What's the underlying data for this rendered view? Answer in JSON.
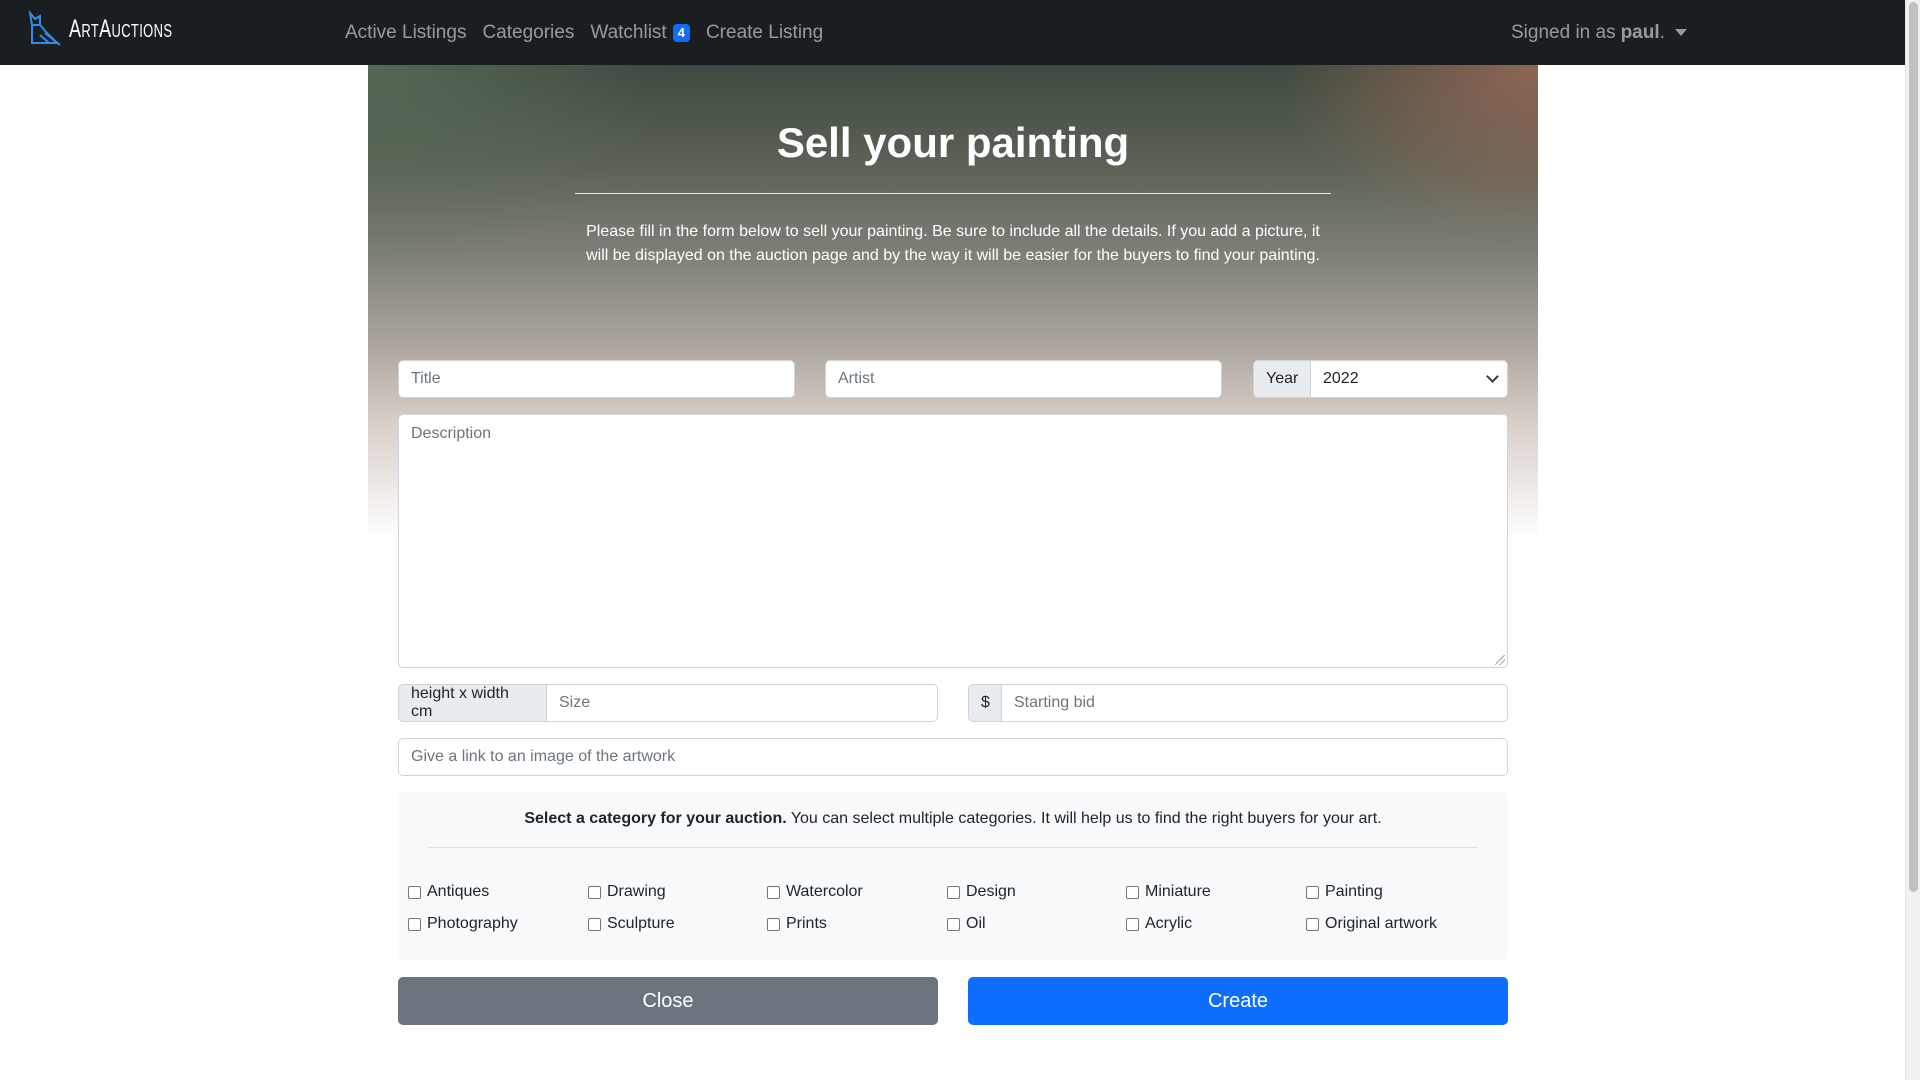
{
  "brand": {
    "name": "ArtAuctions",
    "icon": "cat-logo-icon"
  },
  "nav": {
    "active_listings": "Active Listings",
    "categories": "Categories",
    "watchlist": "Watchlist",
    "watchlist_count": "4",
    "create_listing": "Create Listing",
    "signed_in_prefix": "Signed in as",
    "username": "paul",
    "signed_in_suffix": "."
  },
  "hero": {
    "title": "Sell your painting",
    "text": "Please fill in the form below to sell your painting. Be sure to include all the details. If you add a picture, it will be displayed on the auction page and by the way it will be easier for the buyers to find your painting."
  },
  "form": {
    "title_placeholder": "Title",
    "artist_placeholder": "Artist",
    "year_label": "Year",
    "year_value": "2022",
    "description_placeholder": "Description",
    "size_addon": "height x width cm",
    "size_placeholder": "Size",
    "bid_addon": "$",
    "bid_placeholder": "Starting bid",
    "image_placeholder": "Give a link to an image of the artwork"
  },
  "categories": {
    "intro_bold": "Select a category for your auction.",
    "intro_rest": " You can select multiple categories. It will help us to find the right buyers for your art.",
    "items": [
      "Antiques",
      "Drawing",
      "Watercolor",
      "Design",
      "Miniature",
      "Painting",
      "Photography",
      "Sculpture",
      "Prints",
      "Oil",
      "Acrylic",
      "Original artwork"
    ]
  },
  "buttons": {
    "close": "Close",
    "create": "Create"
  },
  "colors": {
    "navbar": "#1a1e21",
    "primary": "#0d6efd",
    "secondary": "#6c757d"
  }
}
